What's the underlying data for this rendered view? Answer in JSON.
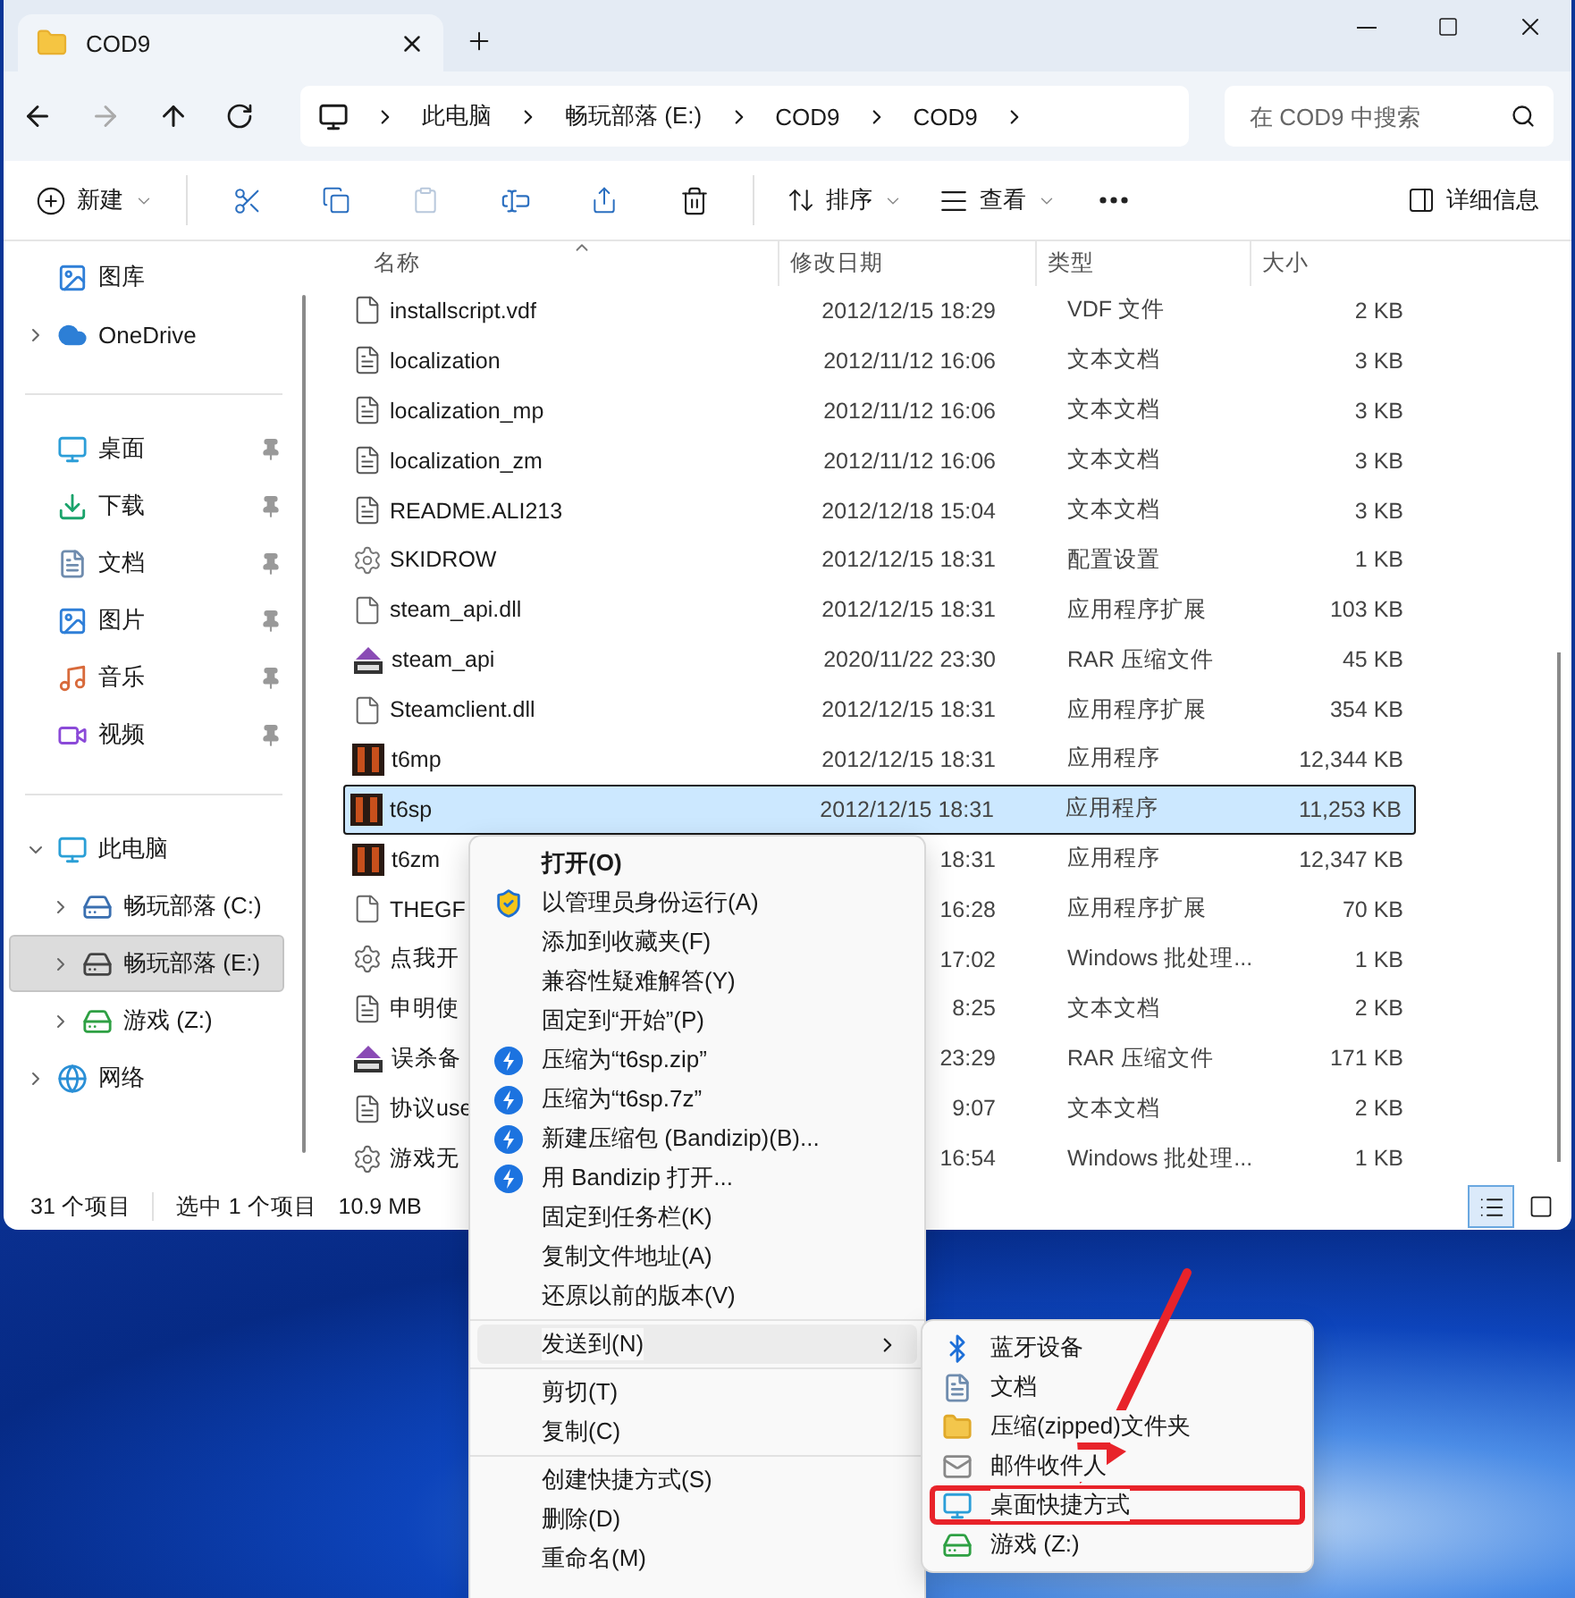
{
  "window": {
    "tab_title": "COD9"
  },
  "address": {
    "crumbs": [
      "此电脑",
      "畅玩部落 (E:)",
      "COD9",
      "COD9"
    ],
    "search": {
      "placeholder": "在 COD9 中搜索"
    }
  },
  "toolbar": {
    "new": "新建",
    "sort": "排序",
    "view": "查看",
    "details": "详细信息",
    "paste_disabled": true
  },
  "sidebar": {
    "groups": [
      [
        {
          "label": "图库",
          "selected": false
        },
        {
          "label": "OneDrive",
          "expanded": false,
          "selected": false
        }
      ],
      [
        {
          "label": "桌面",
          "pinned": true,
          "selected": false
        },
        {
          "label": "下载",
          "pinned": true,
          "selected": false
        },
        {
          "label": "文档",
          "pinned": true,
          "selected": false
        },
        {
          "label": "图片",
          "pinned": true,
          "selected": false
        },
        {
          "label": "音乐",
          "pinned": true,
          "selected": false
        },
        {
          "label": "视频",
          "pinned": true,
          "selected": false
        }
      ],
      [
        {
          "label": "此电脑",
          "expanded": true,
          "selected": false,
          "children": [
            {
              "label": "畅玩部落 (C:)",
              "expanded": false,
              "selected": false
            },
            {
              "label": "畅玩部落 (E:)",
              "expanded": false,
              "selected": true
            },
            {
              "label": "游戏 (Z:)",
              "expanded": false,
              "selected": false
            }
          ]
        },
        {
          "label": "网络",
          "expanded": false,
          "selected": false
        }
      ]
    ]
  },
  "table": {
    "columns": [
      "名称",
      "修改日期",
      "类型",
      "大小"
    ],
    "rows": [
      {
        "kind": "file",
        "name": "installscript.vdf",
        "date": "2012/12/15 18:29",
        "type": "VDF 文件",
        "size": "2 KB",
        "selected": false
      },
      {
        "kind": "text",
        "name": "localization",
        "date": "2012/11/12 16:06",
        "type": "文本文档",
        "size": "3 KB",
        "selected": false
      },
      {
        "kind": "text",
        "name": "localization_mp",
        "date": "2012/11/12 16:06",
        "type": "文本文档",
        "size": "3 KB",
        "selected": false
      },
      {
        "kind": "text",
        "name": "localization_zm",
        "date": "2012/11/12 16:06",
        "type": "文本文档",
        "size": "3 KB",
        "selected": false
      },
      {
        "kind": "text",
        "name": "README.ALI213",
        "date": "2012/12/18 15:04",
        "type": "文本文档",
        "size": "3 KB",
        "selected": false
      },
      {
        "kind": "settings",
        "name": "SKIDROW",
        "date": "2012/12/15 18:31",
        "type": "配置设置",
        "size": "1 KB",
        "selected": false
      },
      {
        "kind": "dll",
        "name": "steam_api.dll",
        "date": "2012/12/15 18:31",
        "type": "应用程序扩展",
        "size": "103 KB",
        "selected": false
      },
      {
        "kind": "rar",
        "name": "steam_api",
        "date": "2020/11/22 23:30",
        "type": "RAR 压缩文件",
        "size": "45 KB",
        "selected": false
      },
      {
        "kind": "dll",
        "name": "Steamclient.dll",
        "date": "2012/12/15 18:31",
        "type": "应用程序扩展",
        "size": "354 KB",
        "selected": false
      },
      {
        "kind": "game",
        "name": "t6mp",
        "date": "2012/12/15 18:31",
        "type": "应用程序",
        "size": "12,344 KB",
        "selected": false
      },
      {
        "kind": "game",
        "name": "t6sp",
        "date": "2012/12/15 18:31",
        "type": "应用程序",
        "size": "11,253 KB",
        "selected": true
      },
      {
        "kind": "game",
        "name": "t6zm",
        "date": "18:31",
        "type": "应用程序",
        "size": "12,347 KB",
        "selected": false
      },
      {
        "kind": "dll",
        "name": "THEGF",
        "date": "16:28",
        "type": "应用程序扩展",
        "size": "70 KB",
        "selected": false
      },
      {
        "kind": "bat",
        "name": "点我开",
        "date": "17:02",
        "type": "Windows 批处理...",
        "size": "1 KB",
        "selected": false
      },
      {
        "kind": "text",
        "name": "申明使",
        "date": "8:25",
        "type": "文本文档",
        "size": "2 KB",
        "selected": false
      },
      {
        "kind": "rar",
        "name": "误杀备",
        "date": "23:29",
        "type": "RAR 压缩文件",
        "size": "171 KB",
        "selected": false
      },
      {
        "kind": "text",
        "name": "协议use",
        "date": "9:07",
        "type": "文本文档",
        "size": "2 KB",
        "selected": false
      },
      {
        "kind": "bat",
        "name": "游戏无",
        "date": "16:54",
        "type": "Windows 批处理...",
        "size": "1 KB",
        "selected": false
      }
    ]
  },
  "status_bar": {
    "count": "31 个项目",
    "selection": "选中 1 个项目",
    "size": "10.9 MB",
    "view_buttons": [
      {
        "selected": true
      },
      {
        "selected": false
      }
    ]
  },
  "context_menu": {
    "items": [
      {
        "kind": "item",
        "label": "打开(O)",
        "bold": true
      },
      {
        "kind": "item",
        "label": "以管理员身份运行(A)",
        "bold": false
      },
      {
        "kind": "item",
        "label": "添加到收藏夹(F)",
        "bold": false
      },
      {
        "kind": "item",
        "label": "兼容性疑难解答(Y)",
        "bold": false
      },
      {
        "kind": "item",
        "label": "固定到“开始”(P)",
        "bold": false
      },
      {
        "kind": "item",
        "label": "压缩为“t6sp.zip”",
        "bold": false
      },
      {
        "kind": "item",
        "label": "压缩为“t6sp.7z”",
        "bold": false
      },
      {
        "kind": "item",
        "label": "新建压缩包 (Bandizip)(B)...",
        "bold": false
      },
      {
        "kind": "item",
        "label": "用 Bandizip 打开...",
        "bold": false
      },
      {
        "kind": "item",
        "label": "固定到任务栏(K)",
        "bold": false
      },
      {
        "kind": "item",
        "label": "复制文件地址(A)",
        "bold": false
      },
      {
        "kind": "item",
        "label": "还原以前的版本(V)",
        "bold": false
      },
      {
        "kind": "separator"
      },
      {
        "kind": "submenu",
        "label": "发送到(N)",
        "bold": false,
        "expanded": true
      },
      {
        "kind": "separator"
      },
      {
        "kind": "item",
        "label": "剪切(T)",
        "bold": false
      },
      {
        "kind": "item",
        "label": "复制(C)",
        "bold": false
      },
      {
        "kind": "separator"
      },
      {
        "kind": "item",
        "label": "创建快捷方式(S)",
        "bold": false
      },
      {
        "kind": "item",
        "label": "删除(D)",
        "bold": false
      },
      {
        "kind": "item",
        "label": "重命名(M)",
        "bold": false
      }
    ]
  },
  "send_to_menu": {
    "items": [
      {
        "label": "蓝牙设备",
        "highlighted": false
      },
      {
        "label": "文档",
        "highlighted": false
      },
      {
        "label": "压缩(zipped)文件夹",
        "highlighted": false
      },
      {
        "label": "邮件收件人",
        "highlighted": false
      },
      {
        "label": "桌面快捷方式",
        "highlighted": true
      },
      {
        "label": "游戏 (Z:)",
        "highlighted": false
      }
    ]
  }
}
